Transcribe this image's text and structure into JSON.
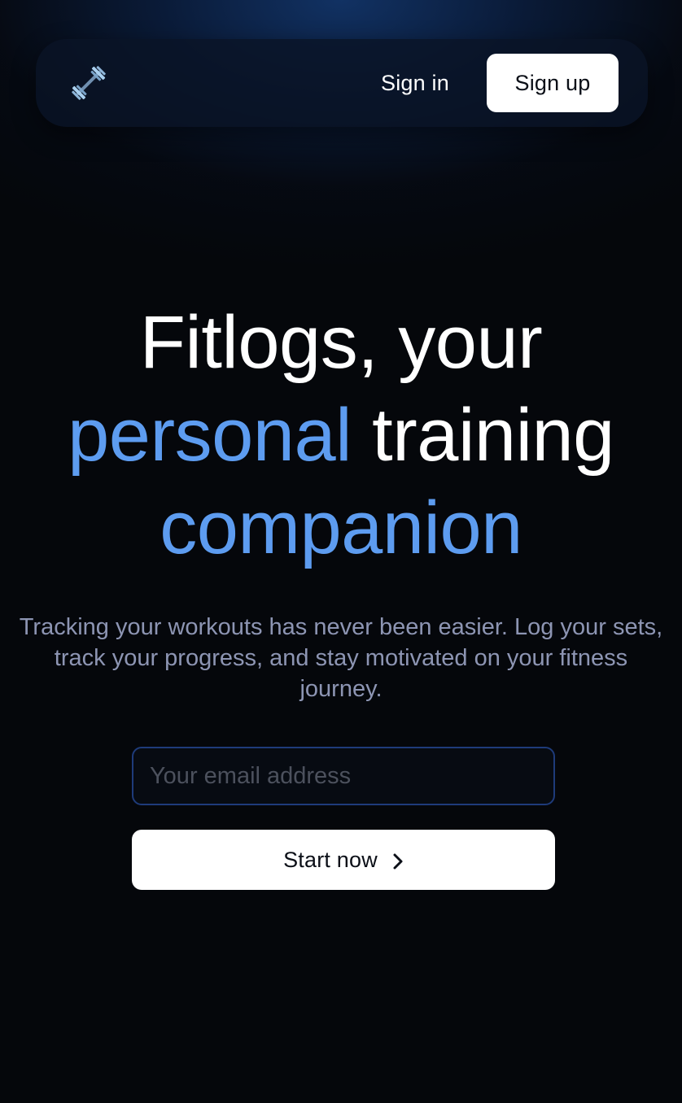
{
  "nav": {
    "logo_icon": "dumbbell-icon",
    "signin_label": "Sign in",
    "signup_label": "Sign up"
  },
  "hero": {
    "line1": "Fitlogs, your",
    "line2_accent": "personal",
    "line2_rest": "training",
    "line3_accent": "companion",
    "subtitle": "Tracking your workouts has never been easier. Log your sets, track your progress, and stay motivated on your fitness journey."
  },
  "form": {
    "email_placeholder": "Your email address",
    "email_value": "",
    "submit_label": "Start now",
    "submit_icon": "chevron-right-icon"
  },
  "colors": {
    "accent": "#5d9cf0",
    "background": "#05070b",
    "glow": "#123468",
    "input_border": "#1e3b7a",
    "subtitle": "#8d95b3"
  }
}
